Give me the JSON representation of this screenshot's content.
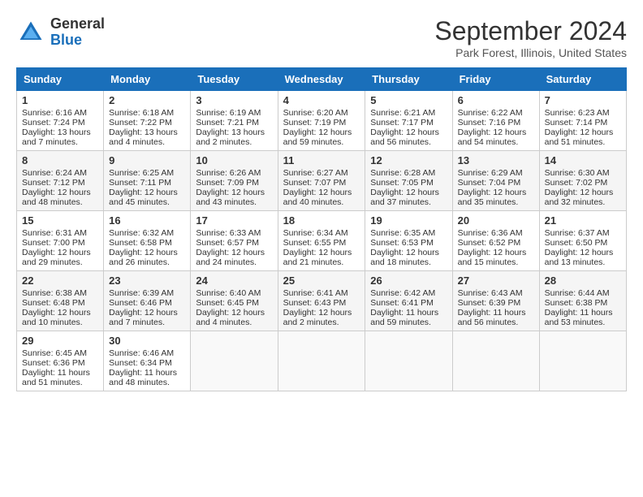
{
  "header": {
    "logo_general": "General",
    "logo_blue": "Blue",
    "title": "September 2024",
    "subtitle": "Park Forest, Illinois, United States"
  },
  "weekdays": [
    "Sunday",
    "Monday",
    "Tuesday",
    "Wednesday",
    "Thursday",
    "Friday",
    "Saturday"
  ],
  "weeks": [
    [
      {
        "day": 1,
        "lines": [
          "Sunrise: 6:16 AM",
          "Sunset: 7:24 PM",
          "Daylight: 13 hours",
          "and 7 minutes."
        ]
      },
      {
        "day": 2,
        "lines": [
          "Sunrise: 6:18 AM",
          "Sunset: 7:22 PM",
          "Daylight: 13 hours",
          "and 4 minutes."
        ]
      },
      {
        "day": 3,
        "lines": [
          "Sunrise: 6:19 AM",
          "Sunset: 7:21 PM",
          "Daylight: 13 hours",
          "and 2 minutes."
        ]
      },
      {
        "day": 4,
        "lines": [
          "Sunrise: 6:20 AM",
          "Sunset: 7:19 PM",
          "Daylight: 12 hours",
          "and 59 minutes."
        ]
      },
      {
        "day": 5,
        "lines": [
          "Sunrise: 6:21 AM",
          "Sunset: 7:17 PM",
          "Daylight: 12 hours",
          "and 56 minutes."
        ]
      },
      {
        "day": 6,
        "lines": [
          "Sunrise: 6:22 AM",
          "Sunset: 7:16 PM",
          "Daylight: 12 hours",
          "and 54 minutes."
        ]
      },
      {
        "day": 7,
        "lines": [
          "Sunrise: 6:23 AM",
          "Sunset: 7:14 PM",
          "Daylight: 12 hours",
          "and 51 minutes."
        ]
      }
    ],
    [
      {
        "day": 8,
        "lines": [
          "Sunrise: 6:24 AM",
          "Sunset: 7:12 PM",
          "Daylight: 12 hours",
          "and 48 minutes."
        ]
      },
      {
        "day": 9,
        "lines": [
          "Sunrise: 6:25 AM",
          "Sunset: 7:11 PM",
          "Daylight: 12 hours",
          "and 45 minutes."
        ]
      },
      {
        "day": 10,
        "lines": [
          "Sunrise: 6:26 AM",
          "Sunset: 7:09 PM",
          "Daylight: 12 hours",
          "and 43 minutes."
        ]
      },
      {
        "day": 11,
        "lines": [
          "Sunrise: 6:27 AM",
          "Sunset: 7:07 PM",
          "Daylight: 12 hours",
          "and 40 minutes."
        ]
      },
      {
        "day": 12,
        "lines": [
          "Sunrise: 6:28 AM",
          "Sunset: 7:05 PM",
          "Daylight: 12 hours",
          "and 37 minutes."
        ]
      },
      {
        "day": 13,
        "lines": [
          "Sunrise: 6:29 AM",
          "Sunset: 7:04 PM",
          "Daylight: 12 hours",
          "and 35 minutes."
        ]
      },
      {
        "day": 14,
        "lines": [
          "Sunrise: 6:30 AM",
          "Sunset: 7:02 PM",
          "Daylight: 12 hours",
          "and 32 minutes."
        ]
      }
    ],
    [
      {
        "day": 15,
        "lines": [
          "Sunrise: 6:31 AM",
          "Sunset: 7:00 PM",
          "Daylight: 12 hours",
          "and 29 minutes."
        ]
      },
      {
        "day": 16,
        "lines": [
          "Sunrise: 6:32 AM",
          "Sunset: 6:58 PM",
          "Daylight: 12 hours",
          "and 26 minutes."
        ]
      },
      {
        "day": 17,
        "lines": [
          "Sunrise: 6:33 AM",
          "Sunset: 6:57 PM",
          "Daylight: 12 hours",
          "and 24 minutes."
        ]
      },
      {
        "day": 18,
        "lines": [
          "Sunrise: 6:34 AM",
          "Sunset: 6:55 PM",
          "Daylight: 12 hours",
          "and 21 minutes."
        ]
      },
      {
        "day": 19,
        "lines": [
          "Sunrise: 6:35 AM",
          "Sunset: 6:53 PM",
          "Daylight: 12 hours",
          "and 18 minutes."
        ]
      },
      {
        "day": 20,
        "lines": [
          "Sunrise: 6:36 AM",
          "Sunset: 6:52 PM",
          "Daylight: 12 hours",
          "and 15 minutes."
        ]
      },
      {
        "day": 21,
        "lines": [
          "Sunrise: 6:37 AM",
          "Sunset: 6:50 PM",
          "Daylight: 12 hours",
          "and 13 minutes."
        ]
      }
    ],
    [
      {
        "day": 22,
        "lines": [
          "Sunrise: 6:38 AM",
          "Sunset: 6:48 PM",
          "Daylight: 12 hours",
          "and 10 minutes."
        ]
      },
      {
        "day": 23,
        "lines": [
          "Sunrise: 6:39 AM",
          "Sunset: 6:46 PM",
          "Daylight: 12 hours",
          "and 7 minutes."
        ]
      },
      {
        "day": 24,
        "lines": [
          "Sunrise: 6:40 AM",
          "Sunset: 6:45 PM",
          "Daylight: 12 hours",
          "and 4 minutes."
        ]
      },
      {
        "day": 25,
        "lines": [
          "Sunrise: 6:41 AM",
          "Sunset: 6:43 PM",
          "Daylight: 12 hours",
          "and 2 minutes."
        ]
      },
      {
        "day": 26,
        "lines": [
          "Sunrise: 6:42 AM",
          "Sunset: 6:41 PM",
          "Daylight: 11 hours",
          "and 59 minutes."
        ]
      },
      {
        "day": 27,
        "lines": [
          "Sunrise: 6:43 AM",
          "Sunset: 6:39 PM",
          "Daylight: 11 hours",
          "and 56 minutes."
        ]
      },
      {
        "day": 28,
        "lines": [
          "Sunrise: 6:44 AM",
          "Sunset: 6:38 PM",
          "Daylight: 11 hours",
          "and 53 minutes."
        ]
      }
    ],
    [
      {
        "day": 29,
        "lines": [
          "Sunrise: 6:45 AM",
          "Sunset: 6:36 PM",
          "Daylight: 11 hours",
          "and 51 minutes."
        ]
      },
      {
        "day": 30,
        "lines": [
          "Sunrise: 6:46 AM",
          "Sunset: 6:34 PM",
          "Daylight: 11 hours",
          "and 48 minutes."
        ]
      },
      null,
      null,
      null,
      null,
      null
    ]
  ]
}
